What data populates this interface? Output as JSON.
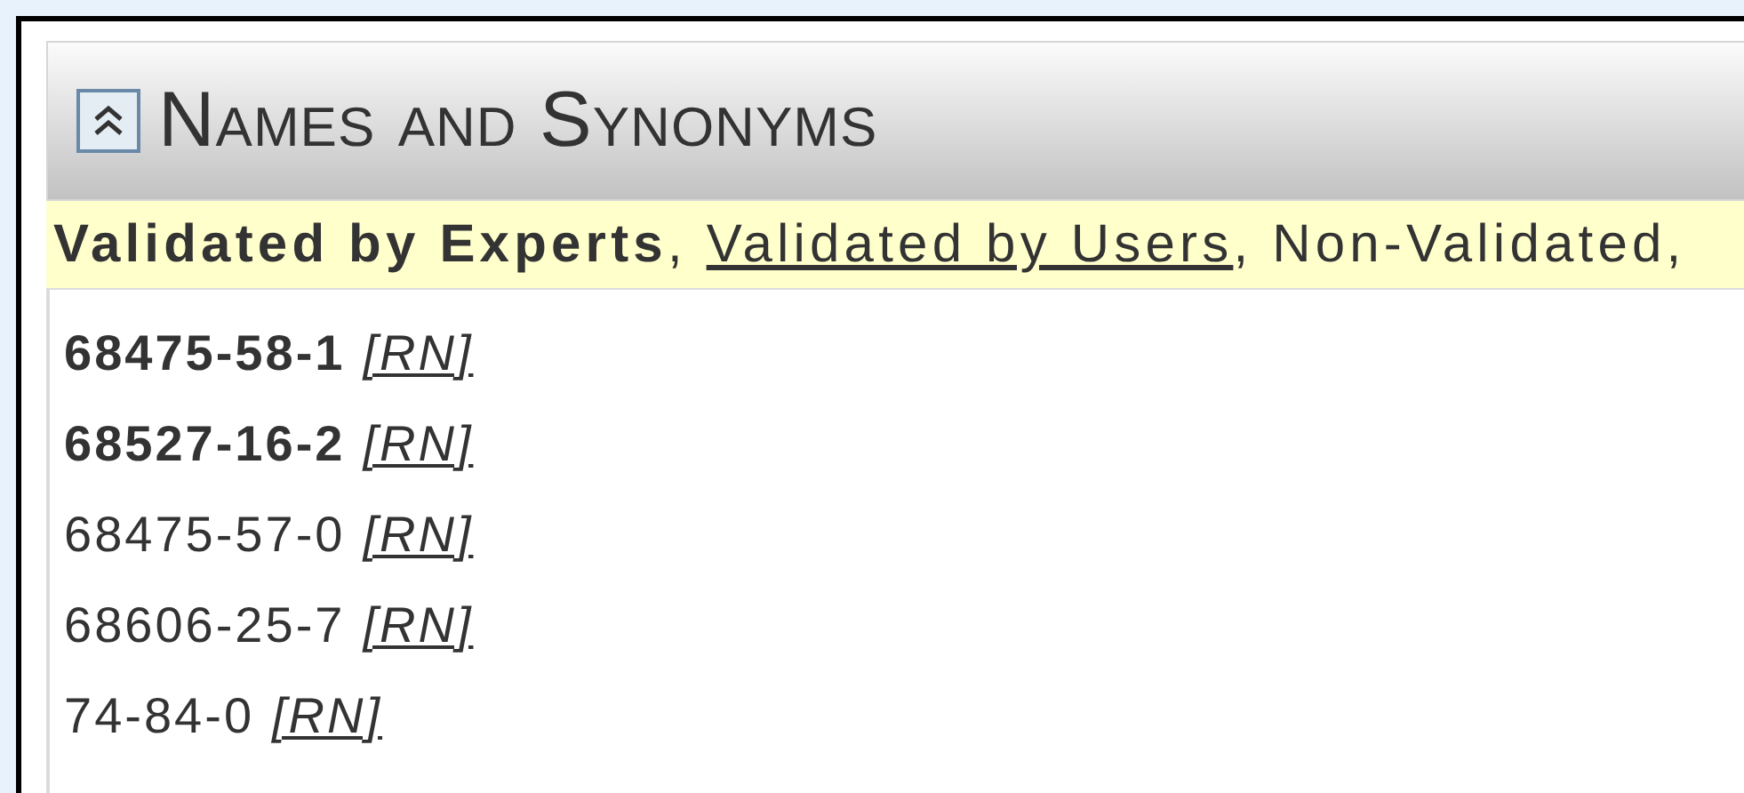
{
  "panel": {
    "title": "Names and Synonyms",
    "legend": [
      {
        "text": "**Validated by Experts**, ",
        "kind": "plain"
      },
      {
        "text": "Validated by Users",
        "kind": "link"
      },
      {
        "text": ", Non-Validated,",
        "kind": "plain"
      }
    ],
    "entries": [
      {
        "number": "68475-58-1",
        "validated": true,
        "tag": "[RN]"
      },
      {
        "number": "68527-16-2",
        "validated": true,
        "tag": "[RN]"
      },
      {
        "number": "68475-57-0",
        "validated": false,
        "tag": "[RN]"
      },
      {
        "number": "68606-25-7",
        "validated": false,
        "tag": "[RN]"
      },
      {
        "number": "74-84-0",
        "validated": false,
        "tag": "[RN]"
      }
    ]
  }
}
